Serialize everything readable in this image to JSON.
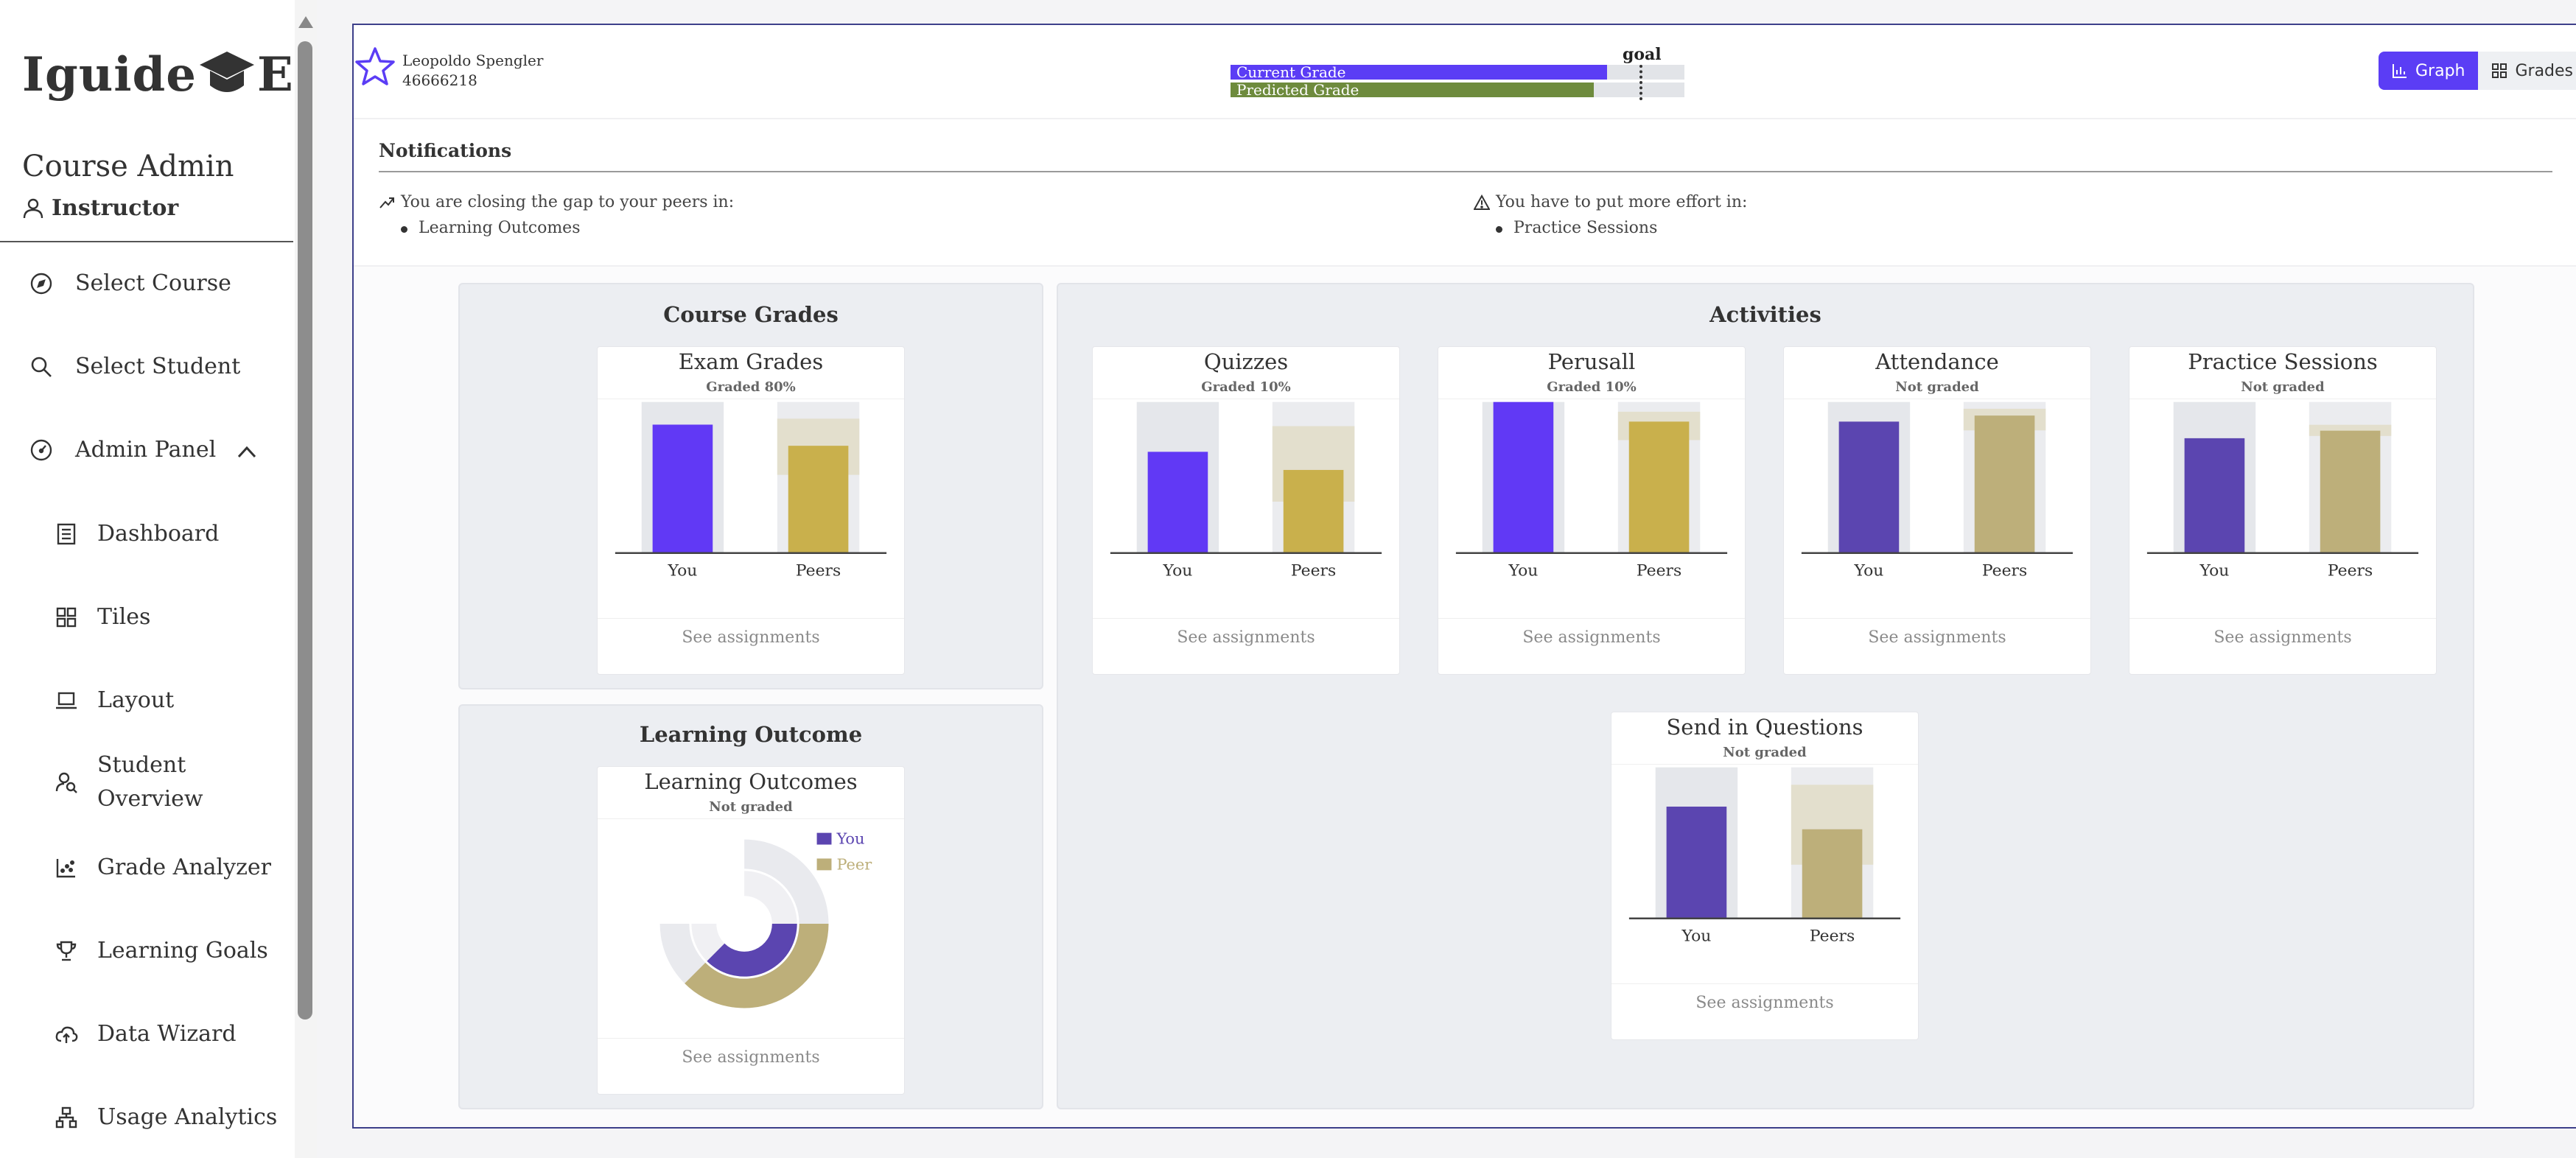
{
  "sidebar": {
    "logo_text_left": "Iguide",
    "logo_text_right": "E",
    "role_title": "Course Admin",
    "role_name": "Instructor",
    "nav": {
      "select_course": "Select Course",
      "select_student": "Select Student",
      "admin_panel": "Admin Panel",
      "dashboard": "Dashboard",
      "tiles": "Tiles",
      "layout": "Layout",
      "student_overview_1": "Student",
      "student_overview_2": "Overview",
      "grade_analyzer": "Grade Analyzer",
      "learning_goals": "Learning Goals",
      "data_wizard": "Data Wizard",
      "usage_analytics": "Usage Analytics"
    }
  },
  "header": {
    "student_name": "Leopoldo Spengler",
    "student_id": "46666218",
    "goal_label": "goal",
    "current_grade_label": "Current Grade",
    "current_grade_fraction": 0.83,
    "predicted_grade_label": "Predicted Grade",
    "predicted_grade_fraction": 0.8,
    "goal_fraction": 0.9,
    "graph_button": "Graph",
    "grades_button": "Grades"
  },
  "notifications": {
    "title": "Notifications",
    "closing_gap_text": "You are closing the gap to your peers in:",
    "closing_gap_items": [
      "Learning Outcomes"
    ],
    "more_effort_text": "You have to put more effort in:",
    "more_effort_items": [
      "Practice Sessions"
    ]
  },
  "panels": {
    "course_grades_title": "Course Grades",
    "activities_title": "Activities",
    "learning_outcome_title": "Learning Outcome"
  },
  "colors": {
    "you_graded": "#6139f5",
    "you_ungraded": "#5b45b0",
    "peer_graded": "#c9b04c",
    "peer_ungraded": "#bdaf7a",
    "track_you": "#e5e7eb",
    "track_peer": "#e3dfcd"
  },
  "see_assignments": "See assignments",
  "you_label": "You",
  "peers_label": "Peers",
  "cards": [
    {
      "id": "exam",
      "title": "Exam Grades",
      "subtitle": "Graded 80%",
      "graded": true,
      "you": 0.85,
      "peer": 0.71,
      "peer_range": 0.55
    },
    {
      "id": "quizzes",
      "title": "Quizzes",
      "subtitle": "Graded 10%",
      "graded": true,
      "you": 0.67,
      "peer": 0.55,
      "peer_range": 0.6
    },
    {
      "id": "perusall",
      "title": "Perusall",
      "subtitle": "Graded 10%",
      "graded": true,
      "you": 1.0,
      "peer": 0.87,
      "peer_range": 0.35
    },
    {
      "id": "attendance",
      "title": "Attendance",
      "subtitle": "Not graded",
      "graded": false,
      "you": 0.87,
      "peer": 0.91,
      "peer_range": 0.28
    },
    {
      "id": "practice",
      "title": "Practice Sessions",
      "subtitle": "Not graded",
      "graded": false,
      "you": 0.76,
      "peer": 0.81,
      "peer_range": 0.1
    },
    {
      "id": "questions",
      "title": "Send in Questions",
      "subtitle": "Not graded",
      "graded": false,
      "you": 0.74,
      "peer": 0.59,
      "peer_range": 0.67
    }
  ],
  "learning_outcomes": {
    "title": "Learning Outcomes",
    "subtitle": "Not graded",
    "legend_you": "You",
    "legend_peer": "Peer",
    "you_value": 0.5,
    "peer_value": 0.5
  }
}
